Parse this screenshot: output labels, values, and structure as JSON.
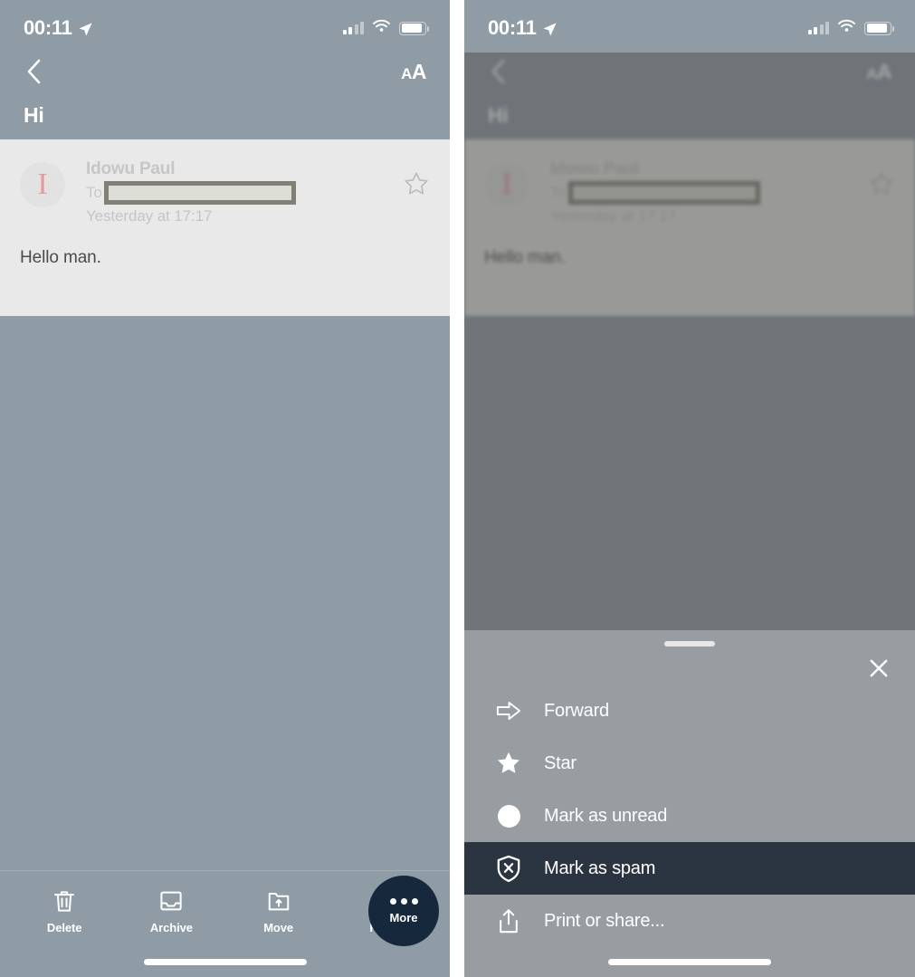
{
  "status_bar": {
    "time": "00:11",
    "location_icon": "location-arrow-icon",
    "signal_icon": "cellular-signal-icon",
    "wifi_icon": "wifi-icon",
    "battery_icon": "battery-icon"
  },
  "nav": {
    "back_icon": "chevron-left-icon",
    "text_size_label_large": "A",
    "text_size_label_small": "A",
    "subject": "Hi"
  },
  "message": {
    "avatar_initial": "I",
    "sender": "Idowu Paul",
    "to_label": "To",
    "recipient_redacted": "",
    "date": "Yesterday at 17:17",
    "star_icon": "star-outline-icon",
    "body": "Hello man."
  },
  "toolbar": {
    "items": [
      {
        "label": "Delete",
        "icon": "trash-icon"
      },
      {
        "label": "Archive",
        "icon": "archive-box-icon"
      },
      {
        "label": "Move",
        "icon": "move-folder-icon"
      },
      {
        "label": "Reply",
        "icon": "reply-arrow-icon"
      }
    ],
    "more_label": "More",
    "more_icon": "ellipsis-icon"
  },
  "action_sheet": {
    "handle_icon": "drag-handle-icon",
    "close_icon": "close-x-icon",
    "items": [
      {
        "label": "Forward",
        "icon": "forward-arrow-icon",
        "selected": false
      },
      {
        "label": "Star",
        "icon": "star-filled-icon",
        "selected": false
      },
      {
        "label": "Mark as unread",
        "icon": "unread-dot-icon",
        "selected": false
      },
      {
        "label": "Mark as spam",
        "icon": "shield-x-icon",
        "selected": true
      },
      {
        "label": "Print or share...",
        "icon": "share-upload-icon",
        "selected": false
      }
    ]
  },
  "colors": {
    "app_background": "#8f9ca6",
    "message_card": "#e9e9e9",
    "accent_dark": "#16293c",
    "selected_row": "#2b3542",
    "sheet_background": "#989da1",
    "avatar_letter": "#e79a9f"
  }
}
